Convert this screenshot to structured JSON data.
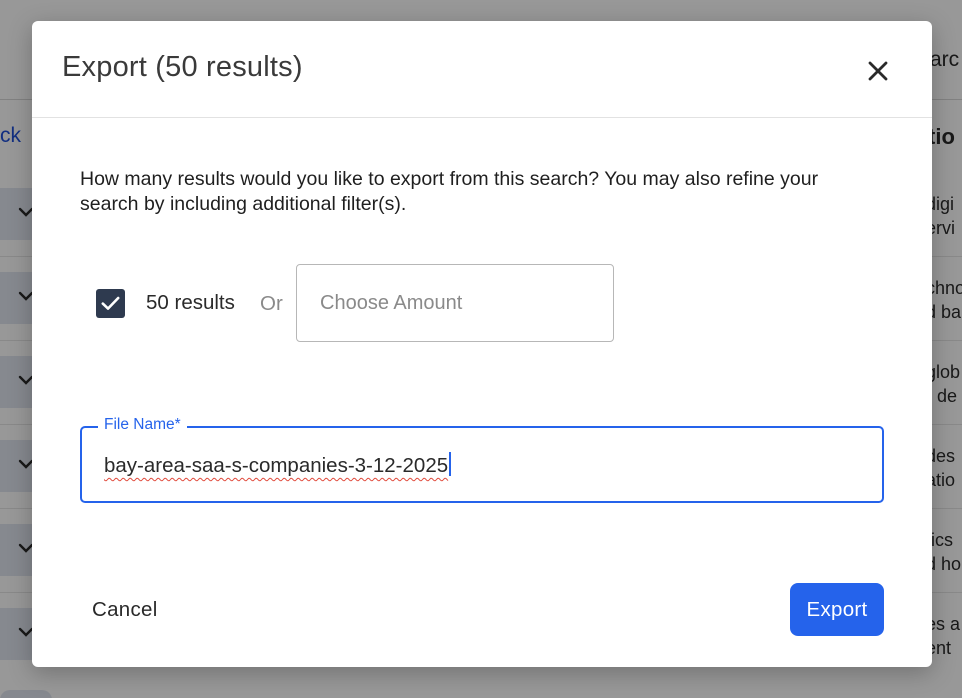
{
  "background": {
    "search_label_partial": "arc",
    "back_link_partial": "ck",
    "section_title_partial": "tio",
    "rows": [
      {
        "line1": "digi",
        "line2": "ervi"
      },
      {
        "line1": "chno",
        "line2": "d ba"
      },
      {
        "line1": "glob",
        "line2": "r de"
      },
      {
        "line1": "des",
        "line2": "atio"
      },
      {
        "line1": "tics",
        "line2": "d ho"
      },
      {
        "line1": "es a",
        "line2": "ent"
      }
    ]
  },
  "modal": {
    "title": "Export (50 results)",
    "close_icon": "close-icon",
    "description": "How many results would you like to export from this search? You may also refine your search by including additional filter(s).",
    "results_option": {
      "checked": true,
      "label": "50 results"
    },
    "or_text": "Or",
    "amount_input": {
      "placeholder": "Choose Amount",
      "value": ""
    },
    "file_name": {
      "label": "File Name*",
      "value": "bay-area-saa-s-companies-3-12-2025"
    },
    "cancel_label": "Cancel",
    "export_label": "Export"
  },
  "colors": {
    "accent": "#2563eb",
    "checkbox": "#2e3a4f",
    "overlay": "rgba(0,0,0,0.40)"
  }
}
